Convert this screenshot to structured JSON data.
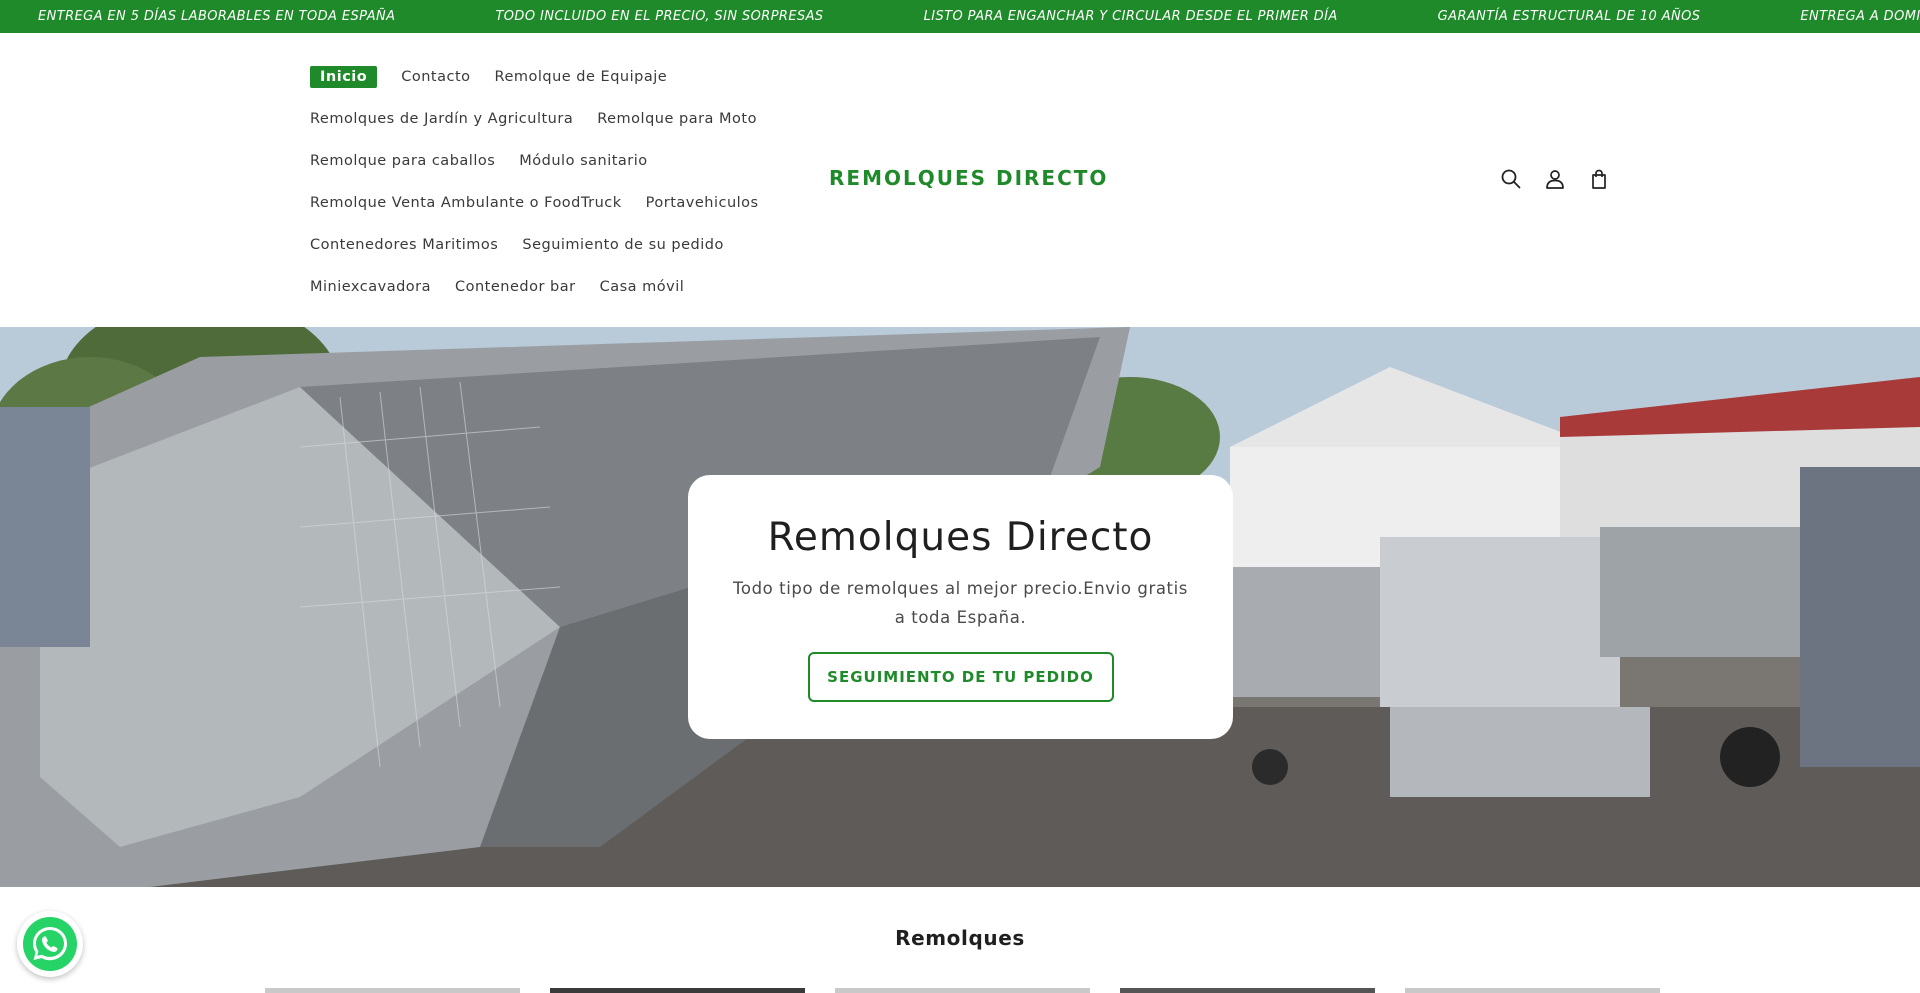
{
  "announcement": {
    "messages": [
      "ENTREGA EN 5 DÍAS LABORABLES EN TODA ESPAÑA",
      "TODO INCLUIDO EN EL PRECIO, SIN SORPRESAS",
      "LISTO PARA ENGANCHAR Y CIRCULAR DESDE EL PRIMER DÍA",
      "GARANTÍA ESTRUCTURAL DE 10 AÑOS",
      "ENTREGA A DOMICILIO"
    ]
  },
  "nav": {
    "rows": [
      [
        "Inicio",
        "Contacto",
        "Remolque de Equipaje"
      ],
      [
        "Remolques de Jardín y Agricultura",
        "Remolque para Moto"
      ],
      [
        "Remolque para caballos",
        "Módulo sanitario"
      ],
      [
        "Remolque Venta Ambulante o FoodTruck",
        "Portavehiculos"
      ],
      [
        "Contenedores Maritimos",
        "Seguimiento de su pedido"
      ],
      [
        "Miniexcavadora",
        "Contenedor bar",
        "Casa móvil"
      ]
    ],
    "active": "Inicio"
  },
  "logo": "REMOLQUES DIRECTO",
  "icons": [
    "search-icon",
    "account-icon",
    "cart-icon"
  ],
  "hero": {
    "title": "Remolques Directo",
    "subtitle": "Todo tipo de remolques al mejor precio.Envio gratis a toda España.",
    "button": "SEGUIMIENTO DE TU PEDIDO"
  },
  "collection": {
    "title": "Remolques"
  },
  "colors": {
    "brand": "#1e8a2a",
    "whatsapp": "#25d366"
  }
}
